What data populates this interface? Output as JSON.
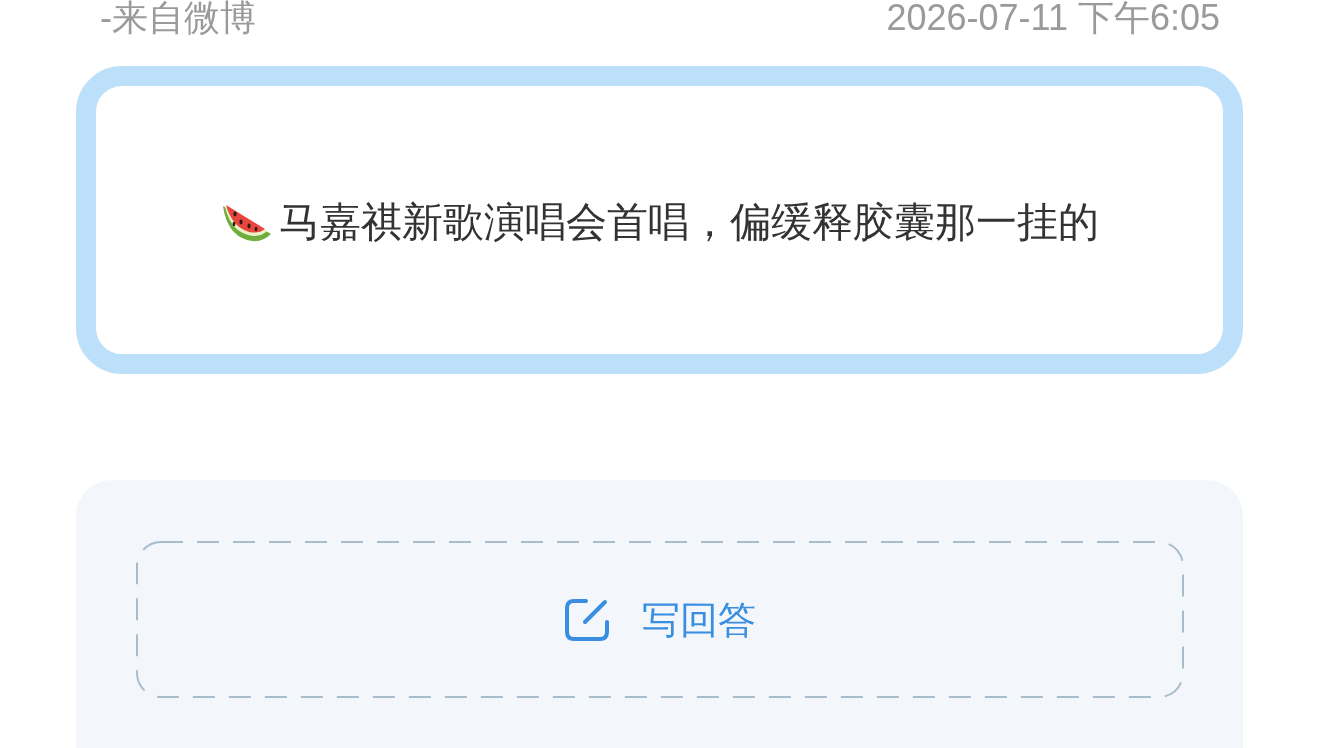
{
  "header": {
    "source": "-来自微博",
    "timestamp": "2026-07-11 下午6:05"
  },
  "question": {
    "text": "马嘉祺新歌演唱会首唱，偏缓释胶囊那一挂的"
  },
  "answer_button": {
    "label": "写回答"
  }
}
